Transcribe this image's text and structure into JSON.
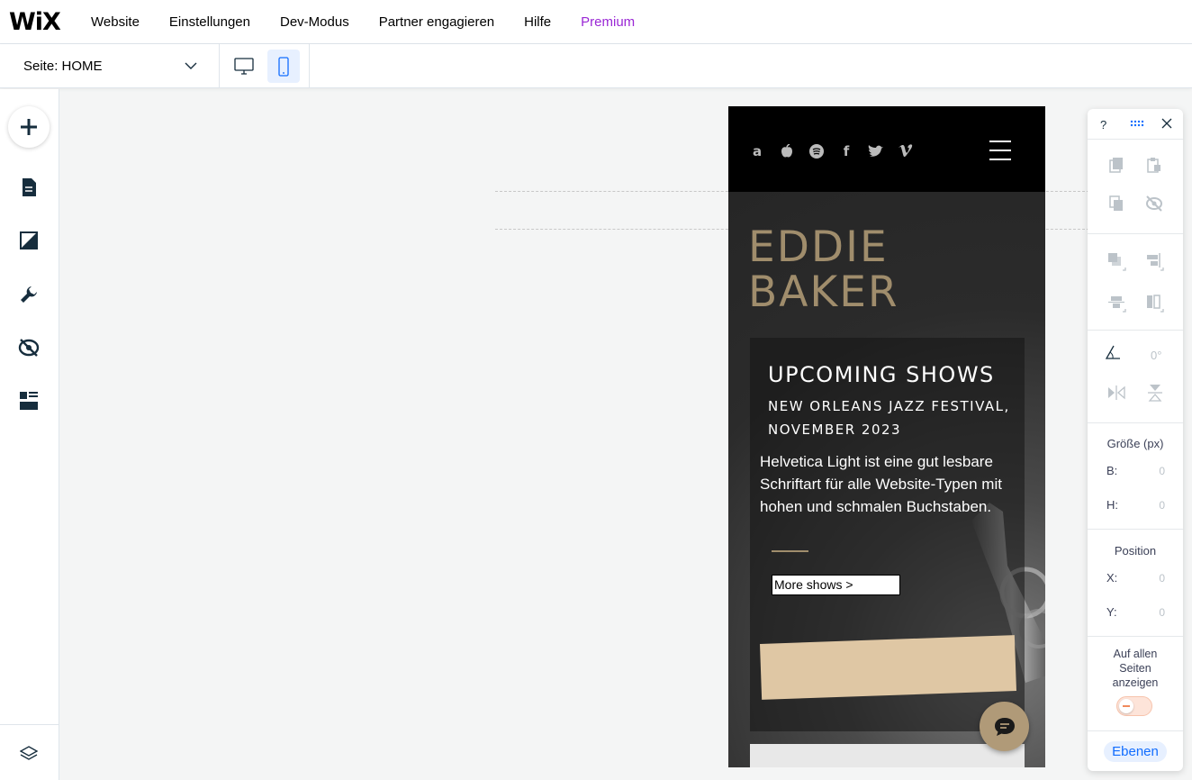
{
  "topbar": {
    "logo": "WiX",
    "menu": [
      "Website",
      "Einstellungen",
      "Dev-Modus",
      "Partner engagieren",
      "Hilfe"
    ],
    "premium": "Premium"
  },
  "subbar": {
    "page_label": "Seite:",
    "page_value": "HOME"
  },
  "site": {
    "social_icons": [
      "amazon-icon",
      "apple-icon",
      "spotify-icon",
      "facebook-icon",
      "twitter-icon",
      "vimeo-icon"
    ],
    "artist_line1": "EDDIE",
    "artist_line2": "BAKER",
    "show_title": "UPCOMING SHOWS",
    "show_subtitle": "NEW ORLEANS JAZZ FESTIVAL, NOVEMBER 2023",
    "description": "Helvetica Light ist eine gut lesbare Schriftart für alle Website-Typen mit hohen und schmalen Buchstaben.",
    "more_button": "More shows >"
  },
  "panel": {
    "help": "?",
    "angle_value": "0°",
    "size_label": "Größe (px)",
    "width_label": "B:",
    "width_value": "0",
    "height_label": "H:",
    "height_value": "0",
    "position_label": "Position",
    "x_label": "X:",
    "x_value": "0",
    "y_label": "Y:",
    "y_value": "0",
    "all_pages_label": "Auf allen Seiten anzeigen",
    "layers_button": "Ebenen"
  },
  "colors": {
    "premium": "#9a27d5",
    "accent_blue": "#116dff",
    "artist_gold": "#a08d6c",
    "tan_strip": "#dfc7a4"
  }
}
